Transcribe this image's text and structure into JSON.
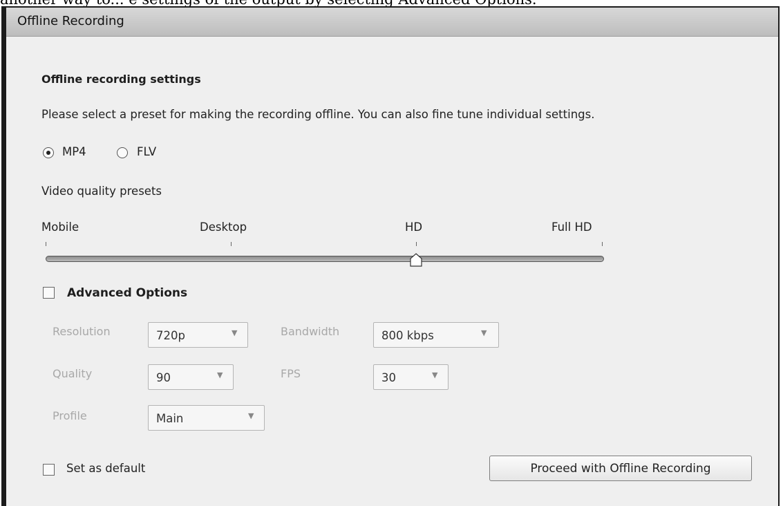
{
  "top_text": "another way to... e settings of the output by selecting Advanced Options.",
  "window": {
    "title": "Offline Recording"
  },
  "settings": {
    "heading": "Offline recording settings",
    "description": "Please select a preset for making the recording offline. You can also fine tune individual settings."
  },
  "format": {
    "options": [
      {
        "label": "MP4",
        "selected": true
      },
      {
        "label": "FLV",
        "selected": false
      }
    ]
  },
  "presets": {
    "label": "Video quality presets",
    "stops": [
      "Mobile",
      "Desktop",
      "HD",
      "Full HD"
    ],
    "selected": "HD"
  },
  "advanced": {
    "label": "Advanced Options",
    "checked": false,
    "fields": {
      "resolution": {
        "label": "Resolution",
        "value": "720p"
      },
      "bandwidth": {
        "label": "Bandwidth",
        "value": "800 kbps"
      },
      "quality": {
        "label": "Quality",
        "value": "90"
      },
      "fps": {
        "label": "FPS",
        "value": "30"
      },
      "profile": {
        "label": "Profile",
        "value": "Main"
      }
    }
  },
  "footer": {
    "default_label": "Set as default",
    "default_checked": false,
    "proceed_label": "Proceed with Offline Recording"
  },
  "icons": {
    "dropdown": "chevron-down-icon",
    "slider_thumb": "slider-thumb-icon"
  }
}
